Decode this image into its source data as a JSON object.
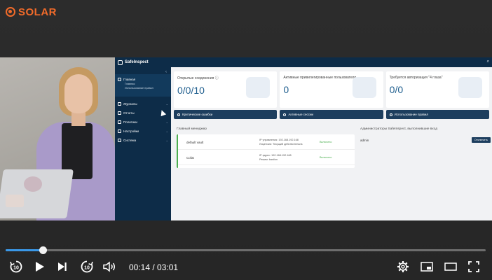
{
  "brand": {
    "name": "SOLAR",
    "color": "#f26b2a"
  },
  "app": {
    "title": "SafeInspect",
    "sidebar": {
      "sections": [
        {
          "label": "Главная",
          "sub": [
            "Главная",
            "Использование правил"
          ]
        }
      ],
      "items": [
        {
          "label": "Журналы"
        },
        {
          "label": "Отчеты"
        },
        {
          "label": "Политики"
        },
        {
          "label": "Настройки"
        },
        {
          "label": "Система"
        }
      ]
    },
    "cards": [
      {
        "title": "Открытые соединения ⓘ",
        "value": "0/0/10"
      },
      {
        "title": "Активные привилегированные пользователи",
        "value": "0"
      },
      {
        "title": "Требуется авторизация \"4 глаза\"",
        "value": "0/0"
      }
    ],
    "alerts": [
      {
        "label": "Критические ошибки"
      },
      {
        "label": "Активные сессии"
      },
      {
        "label": "Использование правил"
      }
    ],
    "manager": {
      "title": "Главный менеджер",
      "rows": [
        {
          "name": "default vault",
          "info1": "IP управления: 192.168.192.168",
          "info2": "Лицензия: Текущий действительна",
          "status": "Включено"
        },
        {
          "name": "Cofat",
          "info1": "IP адрес: 192.168.192.168",
          "info2": "Режим: bastion",
          "status": "Включено"
        }
      ]
    },
    "admins": {
      "title": "Администраторы SafeInspect, выполнившие вход",
      "user": "admin",
      "button": "Отключить"
    }
  },
  "player": {
    "current_time": "00:14",
    "duration": "03:01",
    "time_display": "00:14 / 03:01",
    "progress": 0.077,
    "accent": "#3a98e8",
    "icons": [
      "rewind-10-icon",
      "play-icon",
      "skip-next-icon",
      "forward-10-icon",
      "volume-icon",
      "settings-icon",
      "miniplayer-icon",
      "theater-icon",
      "fullscreen-icon"
    ],
    "rewind_label": "10",
    "forward_label": "10"
  }
}
